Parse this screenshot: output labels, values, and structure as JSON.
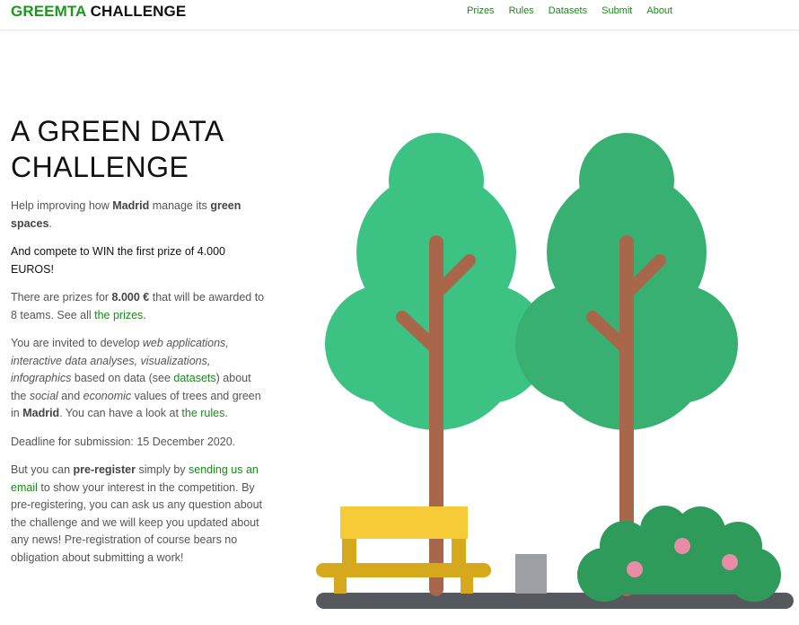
{
  "brand": {
    "part1": "GREEMTA",
    "part2": "CHALLENGE"
  },
  "nav": [
    "Prizes",
    "Rules",
    "Datasets",
    "Submit",
    "About"
  ],
  "hero": {
    "title": "A GREEN DATA CHALLENGE"
  },
  "p1": {
    "t1": "Help improving how ",
    "madrid": "Madrid",
    "t2": " manage its ",
    "green": "green spaces",
    "t3": "."
  },
  "p2": {
    "text": "And compete to WIN the first prize of 4.000 EUROS!"
  },
  "p3": {
    "t1": "There are prizes for ",
    "amount": "8.000 €",
    "t2": " that will be awarded to 8 teams. See all ",
    "link": "the prizes",
    "t3": "."
  },
  "p4": {
    "t1": "You are invited to develop ",
    "i1": "web applications, interactive data analyses, visualizations, infographics",
    "t2": " based on data (see ",
    "link1": "datasets",
    "t3": ") about the ",
    "i2": "social",
    "t4": " and ",
    "i3": "economic",
    "t5": " values of trees and green in ",
    "madrid": "Madrid",
    "t6": ". You can have a look at ",
    "link2": "the rules",
    "t7": "."
  },
  "p5": {
    "text": "Deadline for submission: 15 December 2020."
  },
  "p6": {
    "t1": "But you can ",
    "b1": "pre-register",
    "t2": " simply by ",
    "link": "sending us an email",
    "t3": " to show your interest in the competition. By pre-registering, you can ask us any question about the challenge and we will keep you updated about any news! Pre-registration of course bears no obligation about submitting a work!"
  },
  "colors": {
    "brand_green": "#1a9a1a",
    "link_green": "#1a8a1a",
    "tree_light": "#3cc383",
    "tree_dark": "#38b071",
    "trunk": "#a8664a",
    "bench_top": "#f7cb38",
    "bench_frame": "#d6a81c",
    "ground": "#55595d",
    "bin": "#9ca0a4",
    "bush": "#2e9b5b",
    "flower": "#e88ca8"
  }
}
